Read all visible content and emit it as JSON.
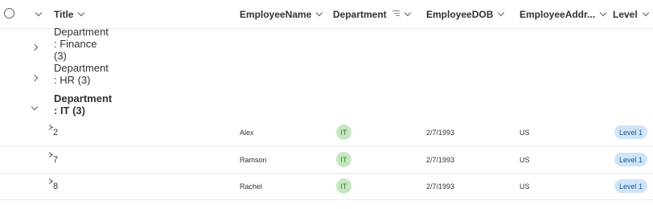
{
  "header": {
    "columns": {
      "title": "Title",
      "employee_name": "EmployeeName",
      "department": "Department",
      "employee_dob": "EmployeeDOB",
      "employee_address": "EmployeeAddr...",
      "level": "Level"
    }
  },
  "groups": [
    {
      "label": "Department : Finance (3)",
      "expanded": false
    },
    {
      "label": "Department : HR (3)",
      "expanded": false
    },
    {
      "label": "Department : IT (3)",
      "expanded": true
    }
  ],
  "rows": [
    {
      "title": "2",
      "employee_name": "Alex",
      "department": "IT",
      "employee_dob": "2/7/1993",
      "employee_address": "US",
      "level": "Level 1"
    },
    {
      "title": "7",
      "employee_name": "Ramson",
      "department": "IT",
      "employee_dob": "2/7/1993",
      "employee_address": "US",
      "level": "Level 1"
    },
    {
      "title": "8",
      "employee_name": "Rachel",
      "department": "IT",
      "employee_dob": "2/7/1993",
      "employee_address": "US",
      "level": "Level 1"
    }
  ],
  "icons": {
    "select_all": "circle-checkbox-icon",
    "collapse_all": "chevron-down-icon",
    "grouped_by": "group-by-icon",
    "new_item": "new-item-sparkle-icon",
    "group_collapsed": "chevron-right-icon",
    "group_expanded": "chevron-down-icon"
  },
  "colors": {
    "department_pill_bg": "#c5e8c1",
    "level_pill_bg": "#cfe4f7",
    "divider": "#edebe9"
  }
}
